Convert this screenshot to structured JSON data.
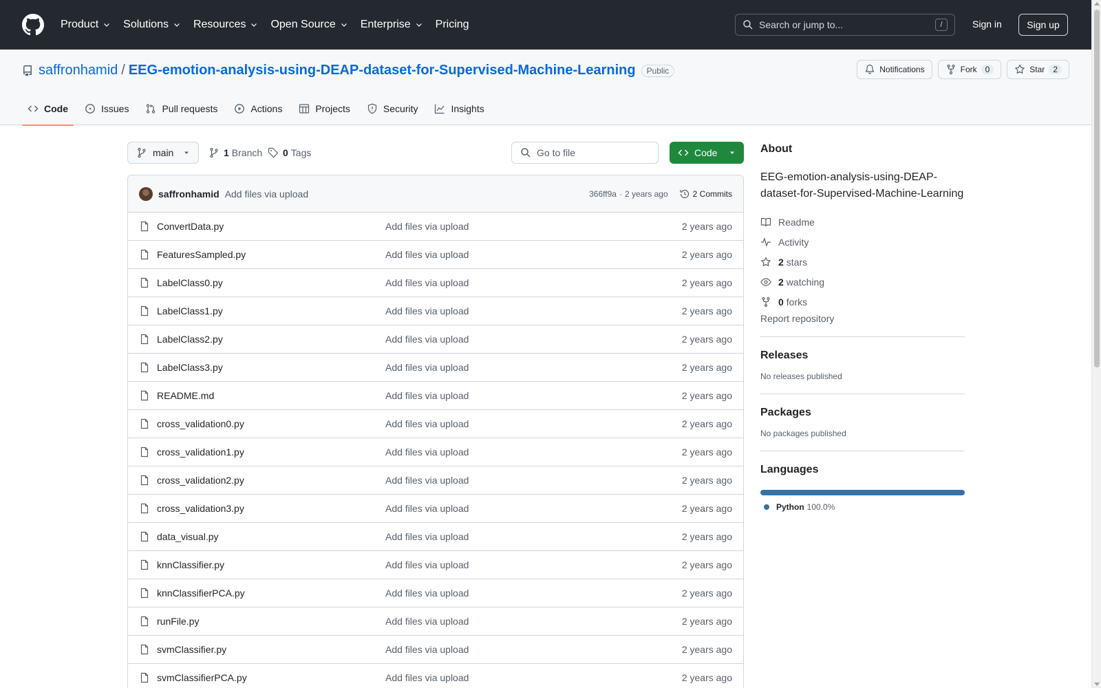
{
  "header": {
    "nav": [
      {
        "label": "Product",
        "dropdown": true
      },
      {
        "label": "Solutions",
        "dropdown": true
      },
      {
        "label": "Resources",
        "dropdown": true
      },
      {
        "label": "Open Source",
        "dropdown": true
      },
      {
        "label": "Enterprise",
        "dropdown": true
      },
      {
        "label": "Pricing",
        "dropdown": false
      }
    ],
    "search_placeholder": "Search or jump to...",
    "search_shortcut": "/",
    "sign_in": "Sign in",
    "sign_up": "Sign up"
  },
  "repo": {
    "owner": "saffronhamid",
    "separator": "/",
    "name": "EEG-emotion-analysis-using-DEAP-dataset-for-Supervised-Machine-Learning",
    "visibility": "Public",
    "notifications_label": "Notifications",
    "fork_label": "Fork",
    "fork_count": "0",
    "star_label": "Star",
    "star_count": "2"
  },
  "tabs": [
    {
      "label": "Code",
      "icon": "code-icon",
      "active": true
    },
    {
      "label": "Issues",
      "icon": "issue-icon",
      "active": false
    },
    {
      "label": "Pull requests",
      "icon": "pull-request-icon",
      "active": false
    },
    {
      "label": "Actions",
      "icon": "play-icon",
      "active": false
    },
    {
      "label": "Projects",
      "icon": "table-icon",
      "active": false
    },
    {
      "label": "Security",
      "icon": "shield-icon",
      "active": false
    },
    {
      "label": "Insights",
      "icon": "graph-icon",
      "active": false
    }
  ],
  "filebar": {
    "branch": "main",
    "branch_count": "1",
    "branch_label": "Branch",
    "tag_count": "0",
    "tag_label": "Tags",
    "goto_placeholder": "Go to file",
    "code_button": "Code"
  },
  "latest_commit": {
    "author": "saffronhamid",
    "message": "Add files via upload",
    "hash": "366ff9a",
    "separator": "·",
    "time": "2 years ago",
    "commits_label": "2 Commits"
  },
  "files": [
    {
      "name": "ConvertData.py",
      "message": "Add files via upload",
      "time": "2 years ago"
    },
    {
      "name": "FeaturesSampled.py",
      "message": "Add files via upload",
      "time": "2 years ago"
    },
    {
      "name": "LabelClass0.py",
      "message": "Add files via upload",
      "time": "2 years ago"
    },
    {
      "name": "LabelClass1.py",
      "message": "Add files via upload",
      "time": "2 years ago"
    },
    {
      "name": "LabelClass2.py",
      "message": "Add files via upload",
      "time": "2 years ago"
    },
    {
      "name": "LabelClass3.py",
      "message": "Add files via upload",
      "time": "2 years ago"
    },
    {
      "name": "README.md",
      "message": "Add files via upload",
      "time": "2 years ago"
    },
    {
      "name": "cross_validation0.py",
      "message": "Add files via upload",
      "time": "2 years ago"
    },
    {
      "name": "cross_validation1.py",
      "message": "Add files via upload",
      "time": "2 years ago"
    },
    {
      "name": "cross_validation2.py",
      "message": "Add files via upload",
      "time": "2 years ago"
    },
    {
      "name": "cross_validation3.py",
      "message": "Add files via upload",
      "time": "2 years ago"
    },
    {
      "name": "data_visual.py",
      "message": "Add files via upload",
      "time": "2 years ago"
    },
    {
      "name": "knnClassifier.py",
      "message": "Add files via upload",
      "time": "2 years ago"
    },
    {
      "name": "knnClassifierPCA.py",
      "message": "Add files via upload",
      "time": "2 years ago"
    },
    {
      "name": "runFile.py",
      "message": "Add files via upload",
      "time": "2 years ago"
    },
    {
      "name": "svmClassifier.py",
      "message": "Add files via upload",
      "time": "2 years ago"
    },
    {
      "name": "svmClassifierPCA.py",
      "message": "Add files via upload",
      "time": "2 years ago"
    }
  ],
  "about": {
    "heading": "About",
    "description": "EEG-emotion-analysis-using-DEAP-dataset-for-Supervised-Machine-Learning",
    "readme": "Readme",
    "activity": "Activity",
    "stars_count": "2",
    "stars_label": "stars",
    "watching_count": "2",
    "watching_label": "watching",
    "forks_count": "0",
    "forks_label": "forks",
    "report": "Report repository"
  },
  "releases": {
    "heading": "Releases",
    "note": "No releases published"
  },
  "packages": {
    "heading": "Packages",
    "note": "No packages published"
  },
  "languages": {
    "heading": "Languages",
    "items": [
      {
        "name": "Python",
        "percent": "100.0%",
        "share": 1.0,
        "color": "#3572A5"
      }
    ]
  },
  "colors": {
    "header_bg": "#24292f",
    "link": "#0969da",
    "primary_button": "#1f883d",
    "active_tab_underline": "#fd8c73"
  }
}
